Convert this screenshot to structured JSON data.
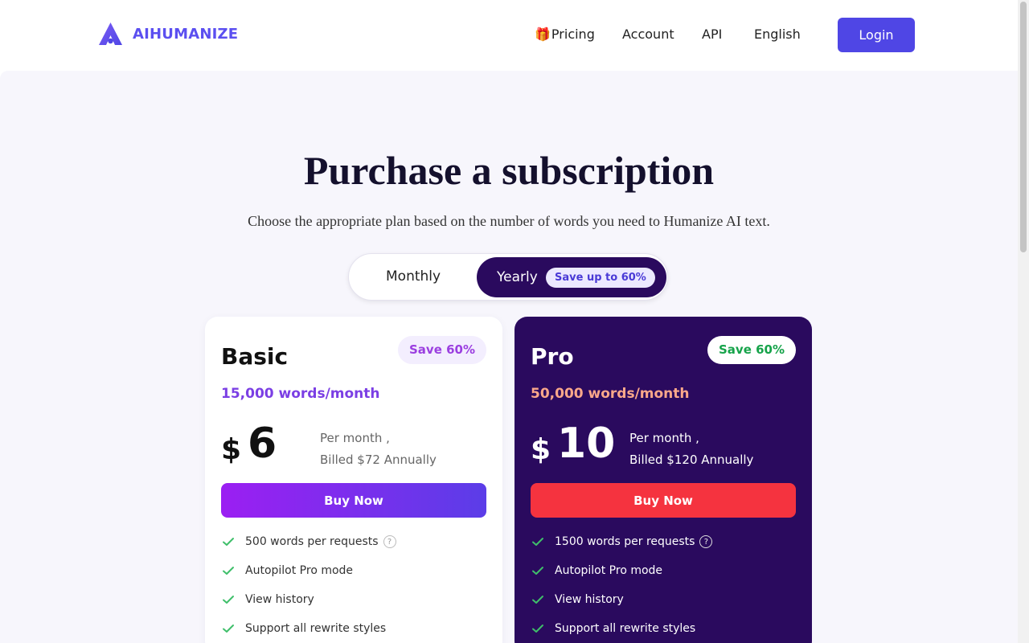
{
  "brand": {
    "name": "AIHUMANIZE",
    "logo_icon": "a-triangle-logo",
    "accent": "#4f46e5"
  },
  "nav": {
    "pricing_icon": "🎁",
    "pricing": "Pricing",
    "account": "Account",
    "api": "API",
    "language": "English",
    "login": "Login"
  },
  "hero": {
    "title": "Purchase a subscription",
    "subtitle": "Choose the appropriate plan based on the number of words you need to Humanize AI text."
  },
  "billing_toggle": {
    "monthly": "Monthly",
    "yearly": "Yearly",
    "yearly_badge": "Save up to 60%",
    "selected": "Yearly"
  },
  "plans": {
    "basic": {
      "name": "Basic",
      "badge": "Save 60%",
      "words": "15,000 words/month",
      "currency": "$",
      "price": "6",
      "per_month": "Per month ,",
      "billed": "Billed $72 Annually",
      "button": "Buy Now",
      "features": [
        "500 words per requests",
        "Autopilot Pro mode",
        "View history",
        "Support all rewrite styles"
      ]
    },
    "pro": {
      "name": "Pro",
      "badge": "Save 60%",
      "words": "50,000 words/month",
      "currency": "$",
      "price": "10",
      "per_month": "Per month ,",
      "billed": "Billed $120 Annually",
      "button": "Buy Now",
      "features": [
        "1500 words per requests",
        "Autopilot Pro mode",
        "View history",
        "Support all rewrite styles"
      ]
    }
  },
  "colors": {
    "pro_card": "#2a0a5e",
    "pro_button": "#f5333f",
    "check": "#3fbf6a"
  }
}
